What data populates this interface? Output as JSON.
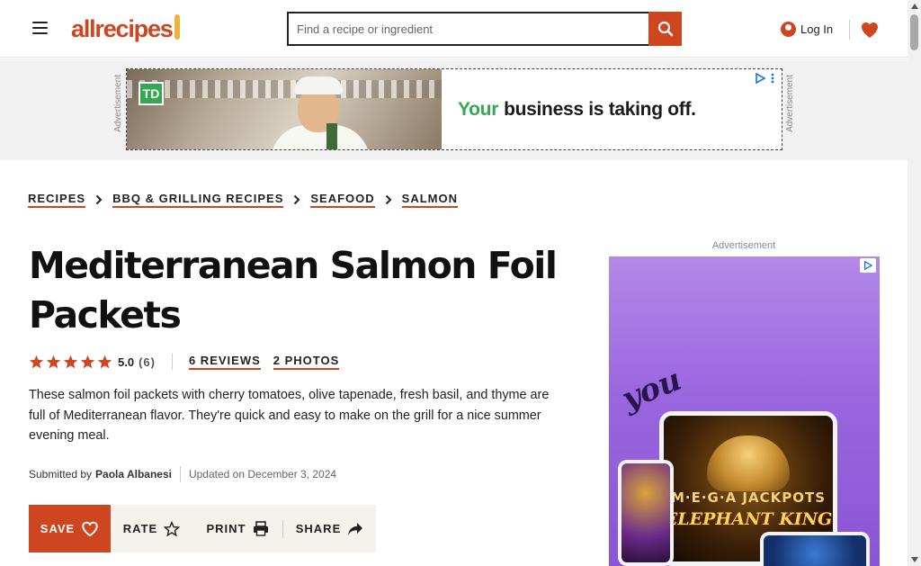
{
  "colors": {
    "brand": "#ce4620",
    "logo_spoon": "#f0b23e",
    "ad_green": "#34a853",
    "action_bar_bg": "#f5f2eb"
  },
  "header": {
    "logo_text": "allrecipes",
    "search_placeholder": "Find a recipe or ingredient",
    "search_icon": "search-icon",
    "login_label": "Log In",
    "menu_icon": "hamburger-menu-icon",
    "saved_icon": "heart-icon"
  },
  "top_ad": {
    "label": "Advertisement",
    "brand_badge": "TD",
    "headline_highlight": "Your",
    "headline_rest": "business is taking off."
  },
  "breadcrumbs": [
    {
      "label": "RECIPES"
    },
    {
      "label": "BBQ & GRILLING RECIPES"
    },
    {
      "label": "SEAFOOD"
    },
    {
      "label": "SALMON"
    }
  ],
  "recipe": {
    "title": "Mediterranean Salmon Foil Packets",
    "rating": {
      "stars": 5,
      "value": "5.0",
      "count": "(6)"
    },
    "reviews_label": "6 REVIEWS",
    "photos_label": "2 PHOTOS",
    "description": "These salmon foil packets with cherry tomatoes, olive tapenade, fresh basil, and thyme are full of Mediterranean flavor. They're quick and easy to make on the grill for a nice summer evening meal.",
    "submitted_by_label": "Submitted by",
    "author": "Paola Albanesi",
    "updated": "Updated on December 3, 2024"
  },
  "actions": {
    "save_label": "SAVE",
    "rate_label": "RATE",
    "print_label": "PRINT",
    "share_label": "SHARE"
  },
  "side_ad": {
    "label": "Advertisement",
    "tagline": "you",
    "brand_line": "M·E·G·A JACKPOTS",
    "game_title": "ELEPHANT KING"
  }
}
